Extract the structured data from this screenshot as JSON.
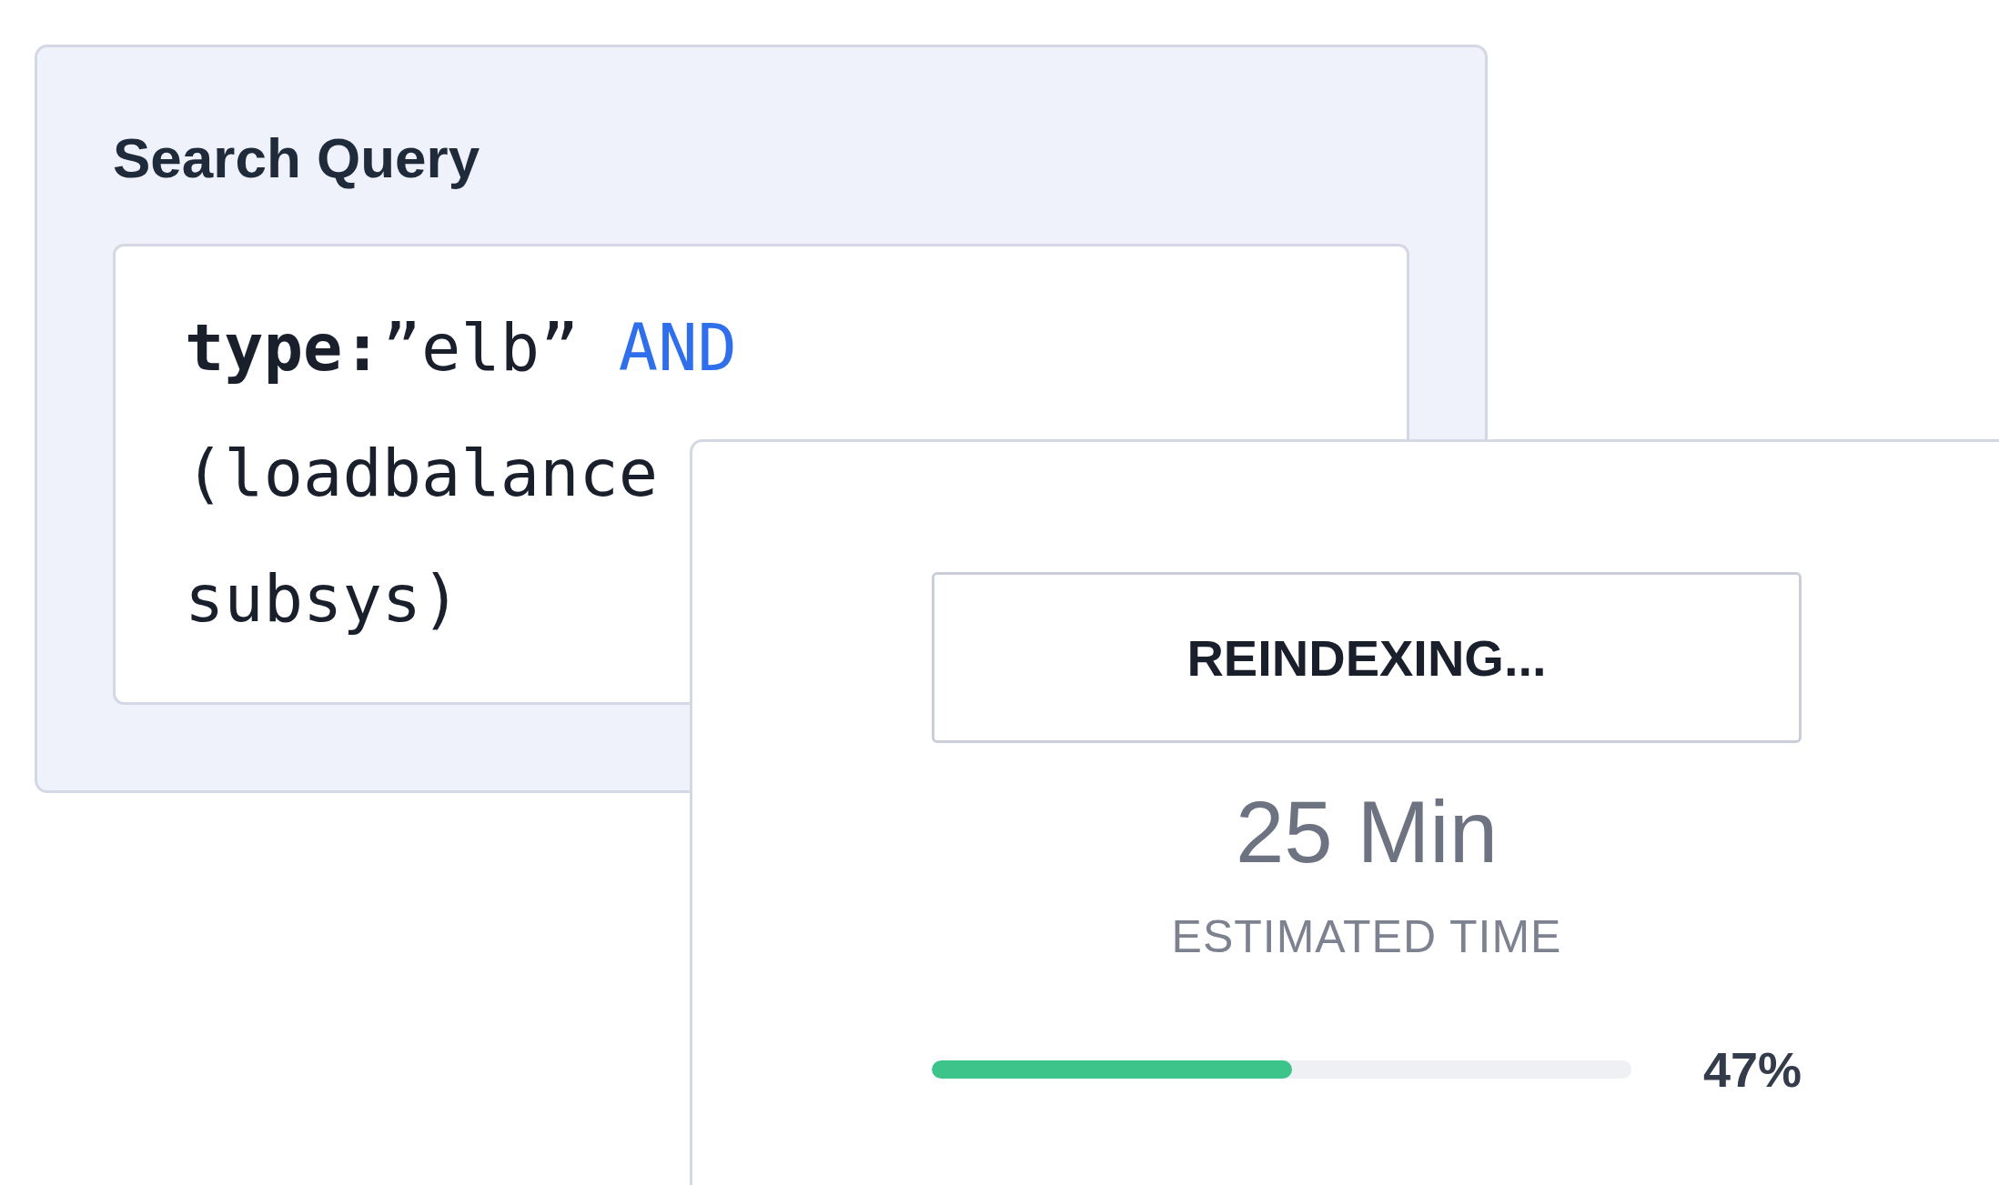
{
  "query_card": {
    "title": "Search Query",
    "code_lines": [
      {
        "tokens": [
          {
            "kind": "keyword",
            "text": "type:"
          },
          {
            "kind": "string",
            "text": "”elb”"
          },
          {
            "kind": "operator",
            "text": " AND"
          }
        ]
      },
      {
        "tokens": [
          {
            "kind": "plain",
            "text": "(loadbalance"
          }
        ]
      },
      {
        "tokens": [
          {
            "kind": "plain",
            "text": "subsys)"
          }
        ]
      }
    ]
  },
  "reindex_card": {
    "status_button": "REINDEXING...",
    "time_value": "25 Min",
    "time_label": "ESTIMATED TIME",
    "progress": {
      "level": 0.515,
      "reading": "47%"
    }
  }
}
